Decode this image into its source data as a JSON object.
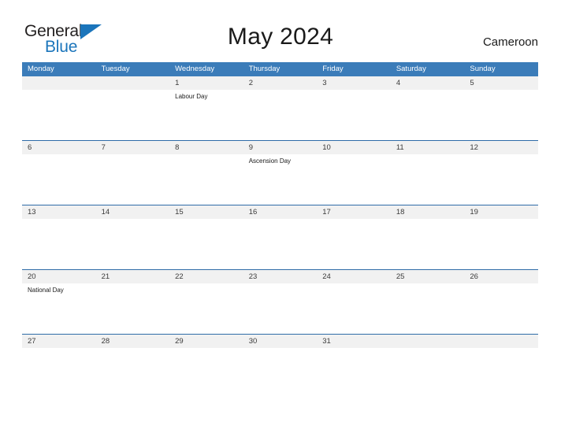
{
  "brand": {
    "name_part1": "General",
    "name_part2": "Blue",
    "flag_icon": "blue-triangle-flag"
  },
  "header": {
    "title": "May 2024",
    "country": "Cameroon"
  },
  "calendar": {
    "weekday_headers": [
      "Monday",
      "Tuesday",
      "Wednesday",
      "Thursday",
      "Friday",
      "Saturday",
      "Sunday"
    ],
    "weeks": [
      [
        {
          "date": "",
          "event": ""
        },
        {
          "date": "",
          "event": ""
        },
        {
          "date": "1",
          "event": "Labour Day"
        },
        {
          "date": "2",
          "event": ""
        },
        {
          "date": "3",
          "event": ""
        },
        {
          "date": "4",
          "event": ""
        },
        {
          "date": "5",
          "event": ""
        }
      ],
      [
        {
          "date": "6",
          "event": ""
        },
        {
          "date": "7",
          "event": ""
        },
        {
          "date": "8",
          "event": ""
        },
        {
          "date": "9",
          "event": "Ascension Day"
        },
        {
          "date": "10",
          "event": ""
        },
        {
          "date": "11",
          "event": ""
        },
        {
          "date": "12",
          "event": ""
        }
      ],
      [
        {
          "date": "13",
          "event": ""
        },
        {
          "date": "14",
          "event": ""
        },
        {
          "date": "15",
          "event": ""
        },
        {
          "date": "16",
          "event": ""
        },
        {
          "date": "17",
          "event": ""
        },
        {
          "date": "18",
          "event": ""
        },
        {
          "date": "19",
          "event": ""
        }
      ],
      [
        {
          "date": "20",
          "event": "National Day"
        },
        {
          "date": "21",
          "event": ""
        },
        {
          "date": "22",
          "event": ""
        },
        {
          "date": "23",
          "event": ""
        },
        {
          "date": "24",
          "event": ""
        },
        {
          "date": "25",
          "event": ""
        },
        {
          "date": "26",
          "event": ""
        }
      ],
      [
        {
          "date": "27",
          "event": ""
        },
        {
          "date": "28",
          "event": ""
        },
        {
          "date": "29",
          "event": ""
        },
        {
          "date": "30",
          "event": ""
        },
        {
          "date": "31",
          "event": ""
        },
        {
          "date": "",
          "event": ""
        },
        {
          "date": "",
          "event": ""
        }
      ]
    ]
  },
  "colors": {
    "header_blue": "#3b7cb9",
    "rule_blue": "#2f6ca8",
    "band_gray": "#f1f1f1",
    "logo_blue": "#1b75bb"
  }
}
